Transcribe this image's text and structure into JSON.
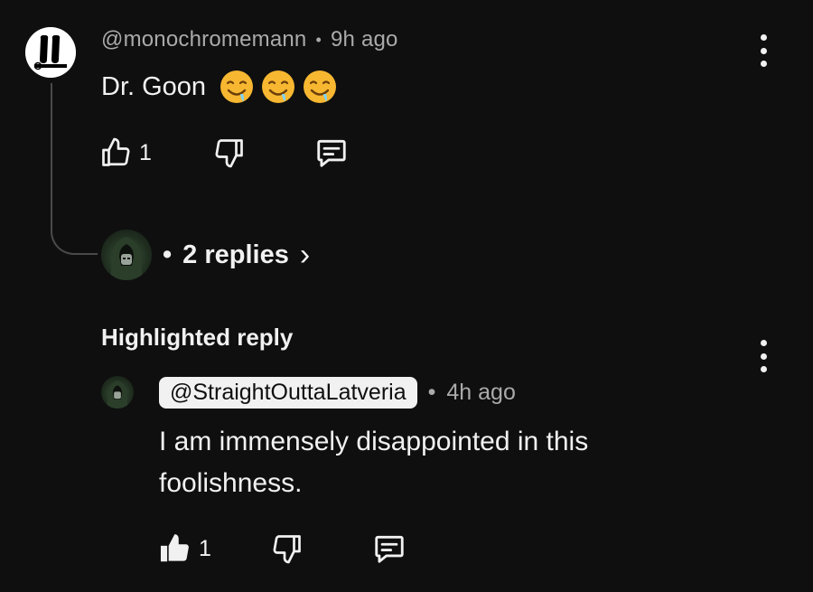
{
  "comment": {
    "handle": "@monochromemann",
    "separator": "•",
    "time": "9h ago",
    "text": "Dr. Goon",
    "emoji_icon": "drooling-face-emoji",
    "emoji_count": 3,
    "like_count": "1"
  },
  "replies": {
    "prefix": "•",
    "label": "2 replies",
    "chevron": "›"
  },
  "highlighted": {
    "heading": "Highlighted reply",
    "handle": "@StraightOuttaLatveria",
    "separator": "•",
    "time": "4h ago",
    "text": "I am immensely disappointed in this foolishness.",
    "like_count": "1"
  },
  "colors": {
    "background": "#0f0f0f",
    "text_primary": "#f1f1f1",
    "text_secondary": "#aaaaaa",
    "thread_line": "#4a4a4a",
    "chip_bg": "#f1f1f1"
  }
}
